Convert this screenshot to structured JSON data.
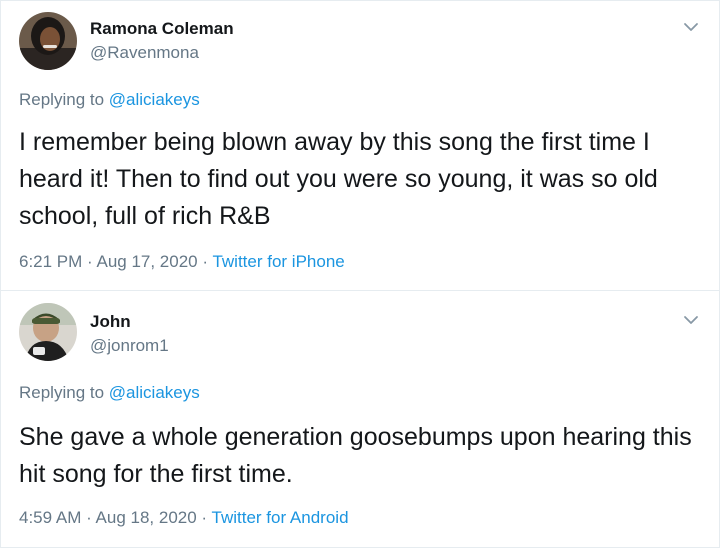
{
  "tweets": [
    {
      "name": "Ramona Coleman",
      "handle": "@Ravenmona",
      "replying_prefix": "Replying to ",
      "replying_to": "@aliciakeys",
      "text": "I remember being blown away by this song the first time I heard it! Then to find out you were so young, it was so old school, full of  rich R&B",
      "time": "6:21 PM",
      "sep1": " · ",
      "date": "Aug 17, 2020",
      "sep2": " · ",
      "source": "Twitter for iPhone",
      "menu_icon": "chevron-down-icon"
    },
    {
      "name": "John",
      "handle": "@jonrom1",
      "replying_prefix": "Replying to ",
      "replying_to": "@aliciakeys",
      "text": "She gave a whole generation goosebumps upon hearing this hit song for the first time.",
      "time": "4:59 AM",
      "sep1": " · ",
      "date": "Aug 18, 2020",
      "sep2": " · ",
      "source": "Twitter for Android",
      "menu_icon": "chevron-down-icon"
    }
  ],
  "colors": {
    "name": "#14171a",
    "muted": "#657786",
    "link": "#1b95e0",
    "divider": "#e6ecf0"
  }
}
